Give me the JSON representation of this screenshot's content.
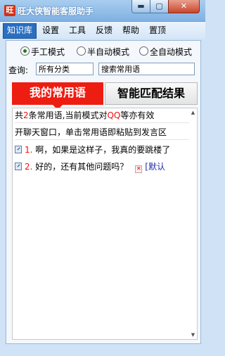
{
  "window": {
    "title": "旺大侠智能客服助手",
    "icon_text": "旺",
    "minimize_glyph": "▬",
    "maximize_glyph": "▢",
    "close_glyph": "✕"
  },
  "menu": [
    "知识库",
    "设置",
    "工具",
    "反馈",
    "帮助",
    "置顶"
  ],
  "modes": [
    {
      "label": "手工模式",
      "selected": true
    },
    {
      "label": "半自动模式",
      "selected": false
    },
    {
      "label": "全自动模式",
      "selected": false
    }
  ],
  "query": {
    "label": "查询:",
    "category_value": "所有分类",
    "search_placeholder": "搜索常用语"
  },
  "tabs": {
    "active": "我的常用语",
    "other": "智能匹配结果"
  },
  "info": {
    "count_prefix": "共",
    "count": "2",
    "count_suffix": "条常用语,当前模式对",
    "qq": "QQ",
    "count_tail": "等亦有效",
    "hint": "开聊天窗口，单击常用语即粘贴到发言区"
  },
  "phrases": [
    {
      "index": "1.",
      "text": "啊，如果是这样子，我真的要跳楼了"
    },
    {
      "index": "2.",
      "text": "好的，还有其他问题吗？",
      "link": "[默认"
    }
  ],
  "scroll": {
    "up_glyph": "▲",
    "down_glyph": "▼"
  },
  "colors": {
    "accent_red": "#ee1d12",
    "menu_active": "#2a6fc1"
  }
}
